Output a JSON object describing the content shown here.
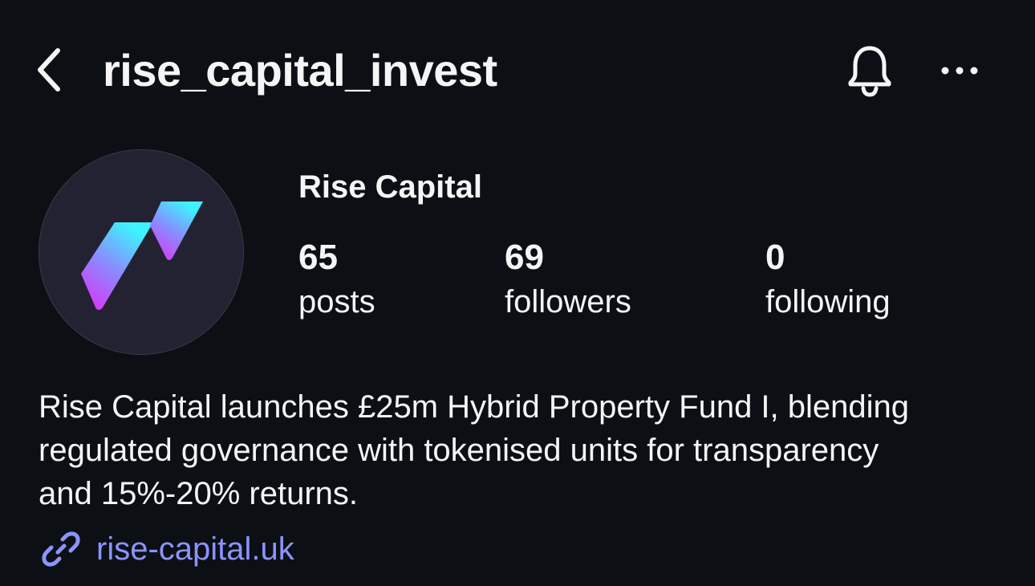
{
  "header": {
    "username": "rise_capital_invest"
  },
  "profile": {
    "display_name": "Rise Capital",
    "stats": [
      {
        "count": "65",
        "label": "posts"
      },
      {
        "count": "69",
        "label": "followers"
      },
      {
        "count": "0",
        "label": "following"
      }
    ],
    "bio_lines": [
      "Rise Capital launches £25m Hybrid Property Fund I, blending",
      "regulated governance with tokenised units for transparency",
      "and 15%-20% returns."
    ],
    "link": "rise-capital.uk"
  },
  "icons": {
    "back": "chevron-left-icon",
    "bell": "bell-icon",
    "more": "more-horizontal-icon",
    "link": "link-icon"
  },
  "colors": {
    "background": "#0c1014",
    "text": "#f5f5f5",
    "link": "#8c93ff",
    "avatar_bg": "#232233",
    "logo_gradient_top": "#3ef2ff",
    "logo_gradient_bottom": "#e22cf5"
  }
}
